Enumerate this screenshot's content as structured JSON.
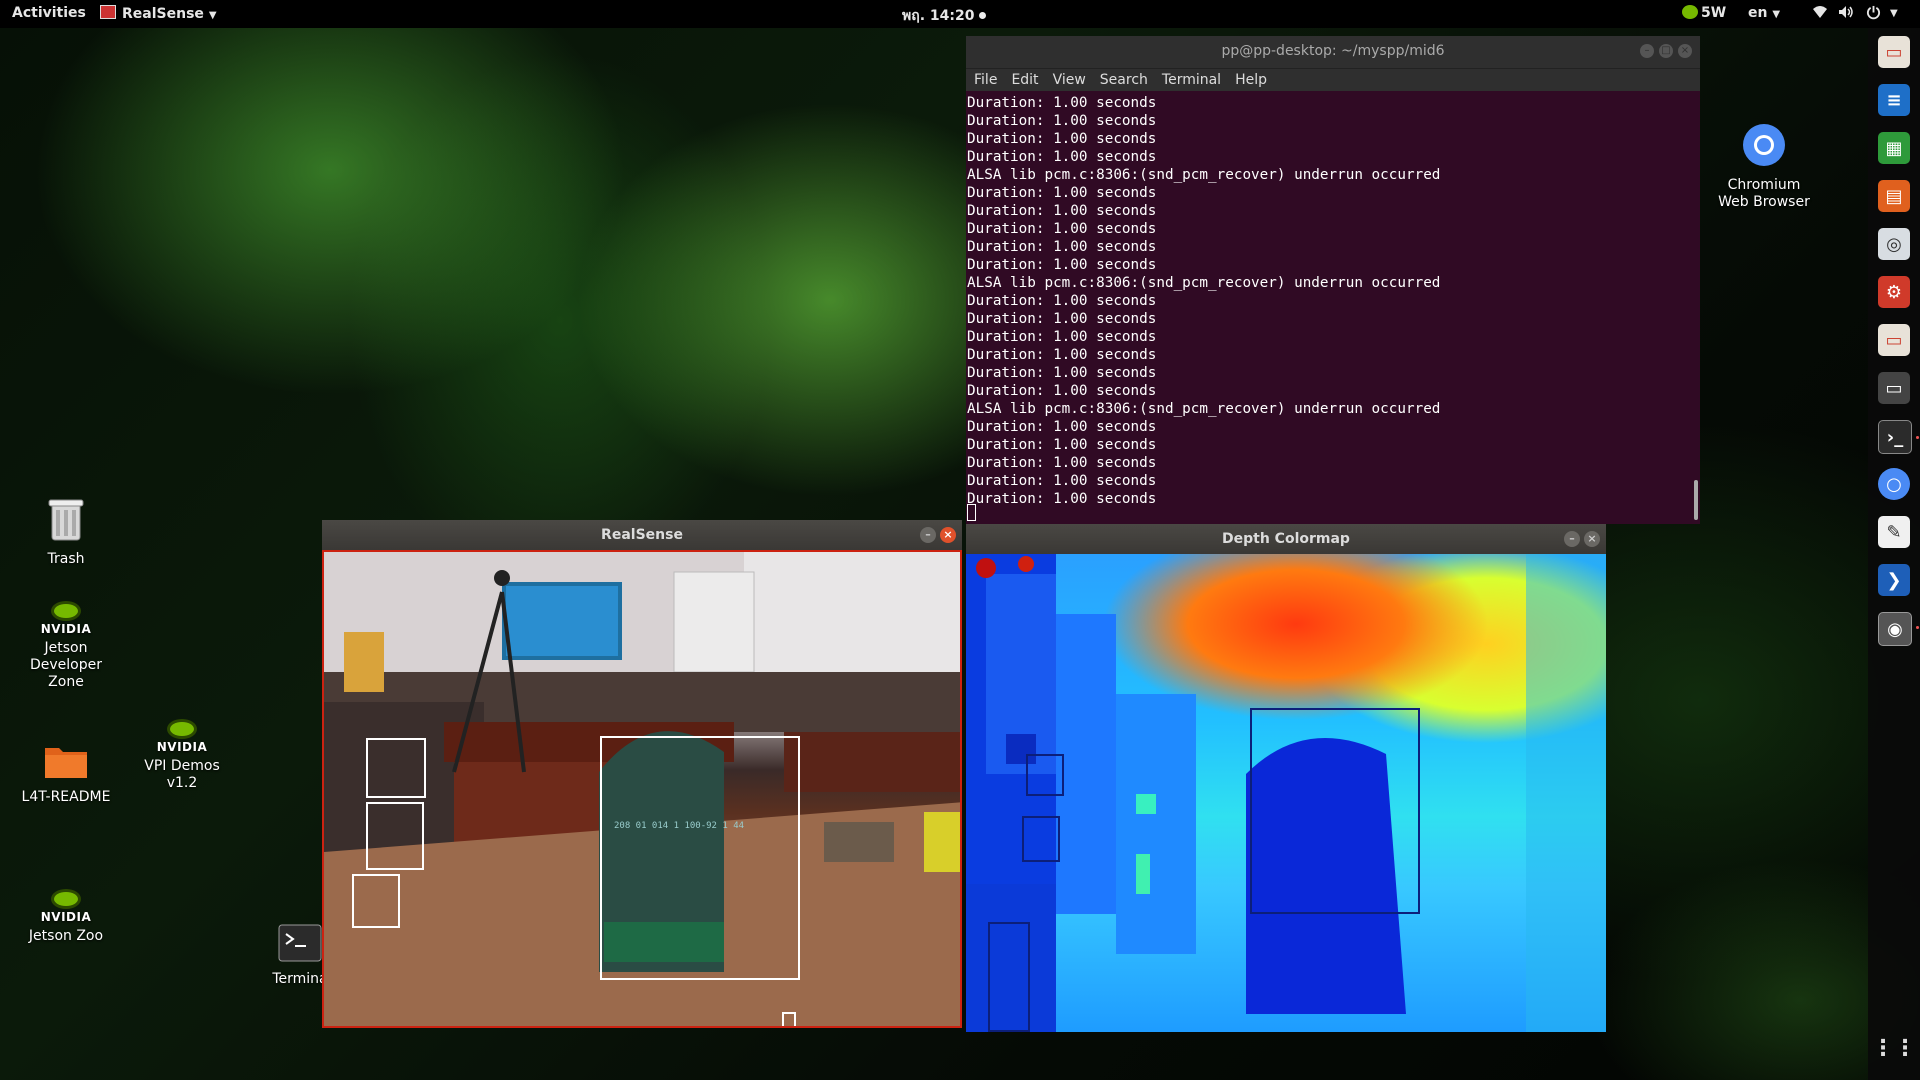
{
  "topbar": {
    "activities": "Activities",
    "app_menu": "RealSense",
    "clock": "พฤ. 14:20",
    "power_mode": "5W",
    "language": "en"
  },
  "desktop_icons": [
    {
      "label": "Trash"
    },
    {
      "label": "Jetson Developer Zone",
      "logo_text": "NVIDIA"
    },
    {
      "label": "VPI Demos v1.2",
      "logo_text": "NVIDIA"
    },
    {
      "label": "L4T-README"
    },
    {
      "label": "Jetson Zoo",
      "logo_text": "NVIDIA"
    },
    {
      "label": "Termina"
    },
    {
      "label": "Chromium Web Browser"
    }
  ],
  "terminal": {
    "title": "pp@pp-desktop: ~/myspp/mid6",
    "menu": [
      "File",
      "Edit",
      "View",
      "Search",
      "Terminal",
      "Help"
    ],
    "lines": [
      "Duration: 1.00 seconds",
      "Duration: 1.00 seconds",
      "Duration: 1.00 seconds",
      "Duration: 1.00 seconds",
      "ALSA lib pcm.c:8306:(snd_pcm_recover) underrun occurred",
      "Duration: 1.00 seconds",
      "Duration: 1.00 seconds",
      "Duration: 1.00 seconds",
      "Duration: 1.00 seconds",
      "Duration: 1.00 seconds",
      "ALSA lib pcm.c:8306:(snd_pcm_recover) underrun occurred",
      "Duration: 1.00 seconds",
      "Duration: 1.00 seconds",
      "Duration: 1.00 seconds",
      "Duration: 1.00 seconds",
      "Duration: 1.00 seconds",
      "Duration: 1.00 seconds",
      "ALSA lib pcm.c:8306:(snd_pcm_recover) underrun occurred",
      "Duration: 1.00 seconds",
      "Duration: 1.00 seconds",
      "Duration: 1.00 seconds",
      "Duration: 1.00 seconds",
      "Duration: 1.00 seconds"
    ]
  },
  "realsense_window": {
    "title": "RealSense",
    "chair_label": "208 01 014 1 100-92 1  44"
  },
  "depth_window": {
    "title": "Depth Colormap"
  },
  "dock": {
    "items": [
      "files",
      "writer",
      "calc",
      "impress",
      "screenshot",
      "settings",
      "archive",
      "display",
      "terminal",
      "chromium",
      "text-editor",
      "vscode",
      "realsense-viewer"
    ]
  }
}
